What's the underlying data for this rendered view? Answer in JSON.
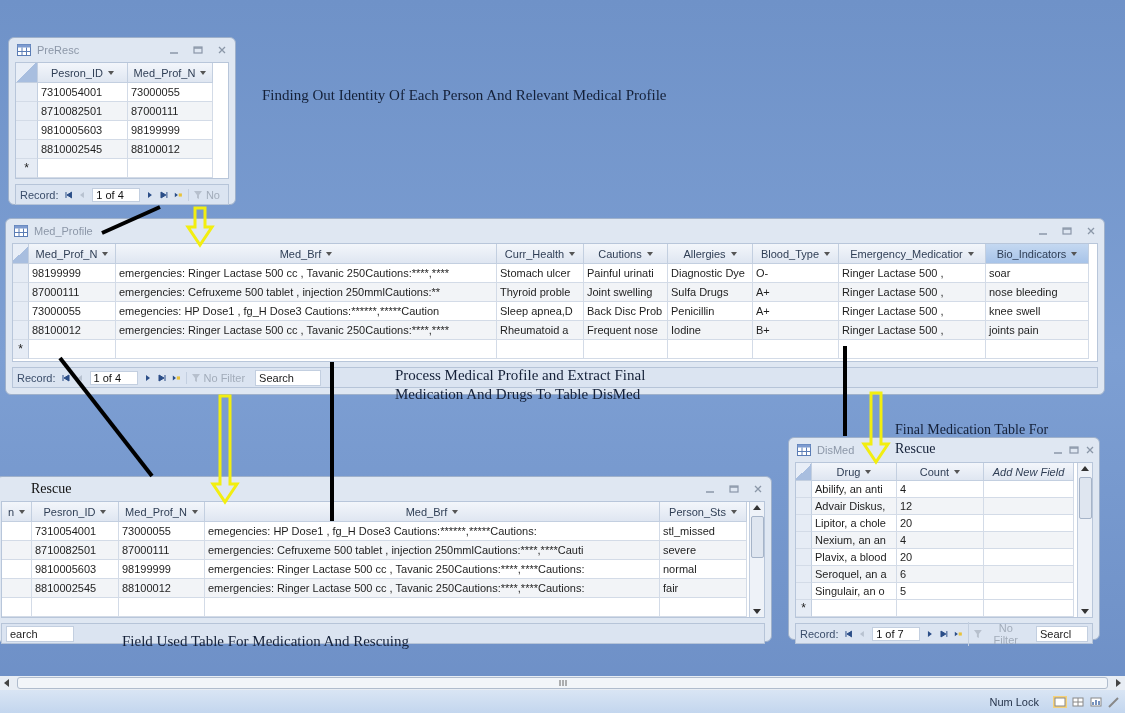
{
  "annotations": [
    {
      "text": "Finding Out Identity Of Each Person And Relevant Medical Profile"
    },
    {
      "text": "Process Medical Profile and Extract Final Medication And Drugs To Table DisMed"
    },
    {
      "text": "Final Medication Table For Rescue"
    },
    {
      "text": "Field Used Table For Medication And Rescuing"
    }
  ],
  "pre_resc": {
    "title": "PreResc",
    "columns": [
      {
        "label": "Pesron_ID",
        "selected": false
      },
      {
        "label": "Med_Prof_N",
        "selected": false
      }
    ],
    "rows": [
      [
        "7310054001",
        "73000055"
      ],
      [
        "8710082501",
        "87000111"
      ],
      [
        "9810005603",
        "98199999"
      ],
      [
        "8810002545",
        "88100012"
      ]
    ],
    "new_row_marker": "*",
    "nav": {
      "record_label": "Record:",
      "position": "1 of 4",
      "filter": "No"
    }
  },
  "med_profile": {
    "title": "Med_Profile",
    "columns": [
      {
        "label": "Med_Prof_N",
        "selected": false
      },
      {
        "label": "Med_Brf",
        "selected": false
      },
      {
        "label": "Curr_Health",
        "selected": false
      },
      {
        "label": "Cautions",
        "selected": false
      },
      {
        "label": "Allergies",
        "selected": false
      },
      {
        "label": "Blood_Type",
        "selected": false
      },
      {
        "label": "Emergency_Medicatior",
        "selected": false
      },
      {
        "label": "Bio_Indicators",
        "selected": true
      }
    ],
    "rows": [
      [
        "98199999",
        "emergencies: Ringer Lactase 500 cc , Tavanic 250Cautions:****,****",
        "Stomach ulcer",
        "Painful urinati",
        "Diagnostic Dye",
        "O-",
        "Ringer Lactase 500 ,",
        "soar"
      ],
      [
        "87000111",
        "emergencies: Cefruxeme 500 tablet , injection 250mmlCautions:**",
        "Thyroid proble",
        "Joint swelling",
        "Sulfa Drugs",
        "A+",
        "Ringer Lactase 500 ,",
        "nose bleeding"
      ],
      [
        "73000055",
        "emegencies: HP Dose1 , fg_H Dose3 Cautions:******,*****Caution",
        "Sleep apnea,D",
        "Back Disc Prob",
        "Penicillin",
        "A+",
        "Ringer Lactase 500 ,",
        "knee swell"
      ],
      [
        "88100012",
        "emergencies: Ringer Lactase 500 cc , Tavanic 250Cautions:****,****",
        "Rheumatoid a",
        "Frequent nose",
        "Iodine",
        "B+",
        "Ringer Lactase 500 ,",
        "joints pain"
      ]
    ],
    "new_row_marker": "*",
    "nav": {
      "record_label": "Record:",
      "position": "1 of 4",
      "filter": "No Filter",
      "search": {
        "placeholder": "Search"
      }
    }
  },
  "rescue": {
    "title": "Rescue",
    "columns": [
      {
        "label": "n",
        "selected": false
      },
      {
        "label": "Pesron_ID",
        "selected": false
      },
      {
        "label": "Med_Prof_N",
        "selected": false
      },
      {
        "label": "Med_Brf",
        "selected": false
      },
      {
        "label": "Person_Sts",
        "selected": false
      }
    ],
    "rows": [
      [
        "",
        "7310054001",
        "73000055",
        "emegencies: HP Dose1 , fg_H Dose3 Cautions:******,*****Cautions:",
        "stl_missed"
      ],
      [
        "",
        "8710082501",
        "87000111",
        "emergencies: Cefruxeme 500 tablet , injection 250mmlCautions:****,****Cauti",
        "severe"
      ],
      [
        "",
        "9810005603",
        "98199999",
        "emergencies: Ringer Lactase 500 cc , Tavanic 250Cautions:****,****Cautions:",
        "normal"
      ],
      [
        "",
        "8810002545",
        "88100012",
        "emergencies: Ringer Lactase 500 cc , Tavanic 250Cautions:****,****Cautions:",
        "fair"
      ]
    ],
    "nav": {
      "search": {
        "placeholder": "earch"
      }
    }
  },
  "dis_med": {
    "title": "DisMed",
    "columns": [
      {
        "label": "Drug",
        "selected": false,
        "kind": "field"
      },
      {
        "label": "Count",
        "selected": false,
        "kind": "field"
      },
      {
        "label": "Add New Field",
        "selected": false,
        "kind": "new_field"
      }
    ],
    "rows": [
      [
        "Abilify, an anti",
        "4",
        ""
      ],
      [
        "Advair Diskus,",
        "12",
        ""
      ],
      [
        "Lipitor, a chole",
        "20",
        ""
      ],
      [
        "Nexium, an an",
        "4",
        ""
      ],
      [
        "Plavix, a blood",
        "20",
        ""
      ],
      [
        "Seroquel, an a",
        "6",
        ""
      ],
      [
        "Singulair, an o",
        "5",
        ""
      ]
    ],
    "new_row_marker": "*",
    "nav": {
      "record_label": "Record:",
      "position": "1 of 7",
      "filter": "No Filter",
      "search": {
        "placeholder": "Searcl"
      }
    }
  },
  "status_bar": {
    "num_lock": "Num Lock"
  }
}
